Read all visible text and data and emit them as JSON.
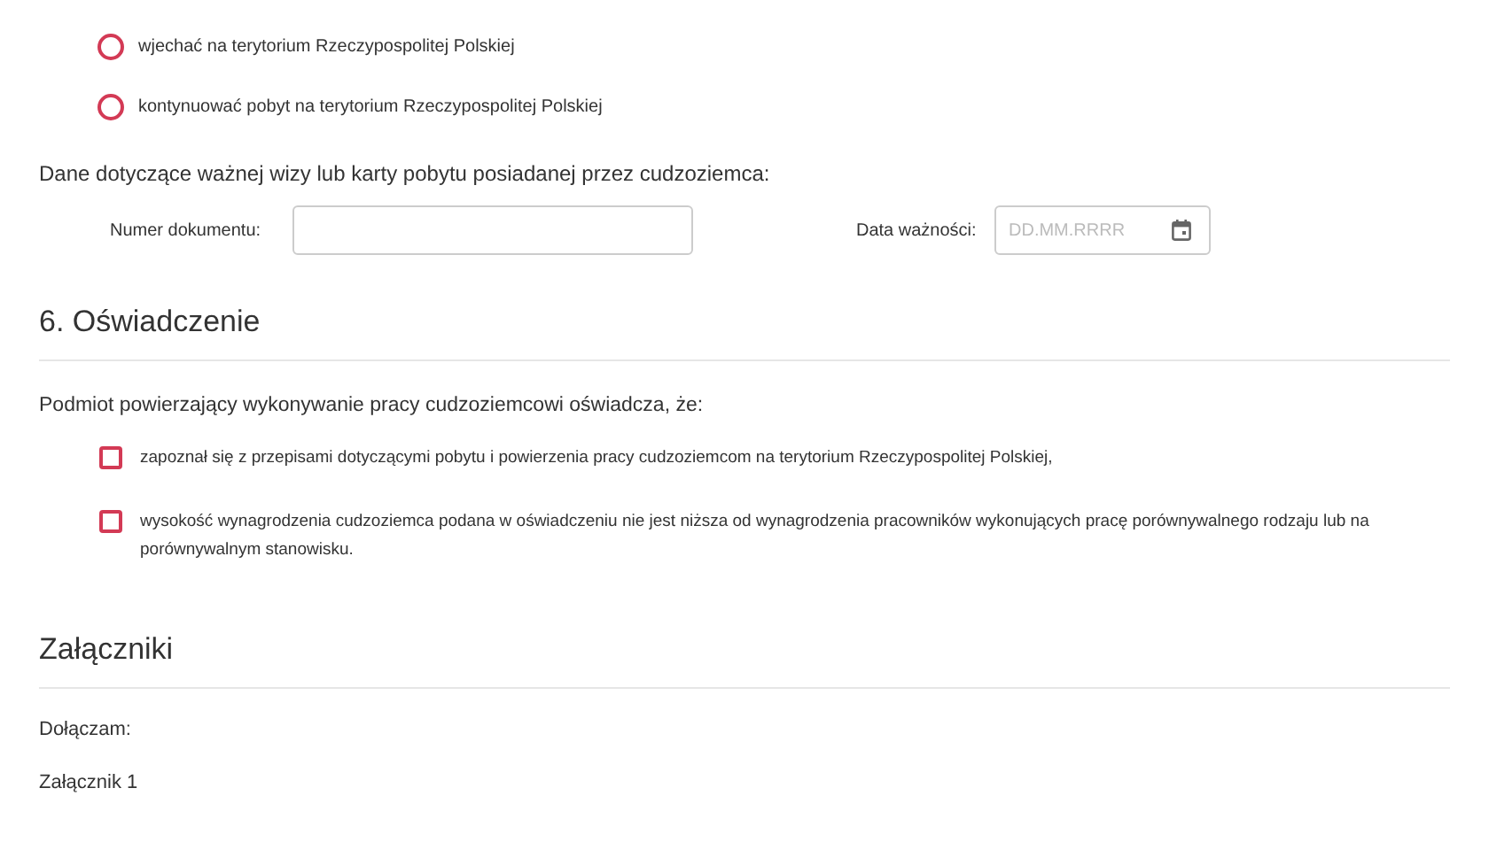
{
  "radios": [
    {
      "label": "wjechać na terytorium Rzeczypospolitej Polskiej",
      "selected": false
    },
    {
      "label": "kontynuować pobyt na terytorium Rzeczypospolitej Polskiej",
      "selected": false
    }
  ],
  "document_section": {
    "heading": "Dane dotyczące ważnej wizy lub karty pobytu posiadanej przez cudzoziemca:",
    "number_label": "Numer dokumentu:",
    "date_label": "Data ważności:",
    "date_placeholder": "DD.MM.RRRR"
  },
  "statement": {
    "title": "6. Oświadczenie",
    "intro": "Podmiot powierzający wykonywanie pracy cudzoziemcowi oświadcza, że:",
    "checkboxes": [
      {
        "label": "zapoznał się z przepisami dotyczącymi pobytu i powierzenia pracy cudzoziemcom na terytorium Rzeczypospolitej Polskiej,",
        "checked": false
      },
      {
        "label": "wysokość wynagrodzenia cudzoziemca podana w oświadczeniu nie jest niższa od wynagrodzenia pracowników wykonujących pracę porównywalnego rodzaju lub na porównywalnym stanowisku.",
        "checked": false
      }
    ]
  },
  "attachments": {
    "title": "Załączniki",
    "intro": "Dołączam:",
    "items": [
      "Załącznik 1"
    ]
  }
}
